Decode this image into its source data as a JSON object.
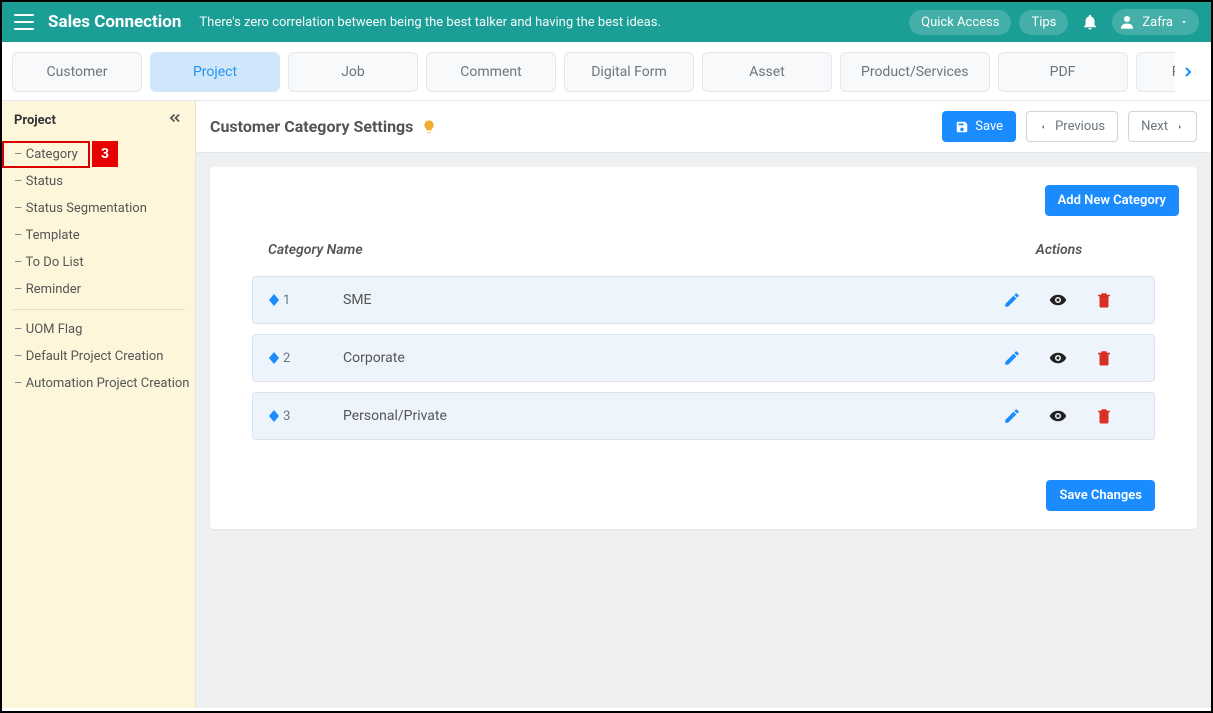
{
  "header": {
    "brand": "Sales Connection",
    "tagline": "There's zero correlation between being the best talker and having the best ideas.",
    "quick_access": "Quick Access",
    "tips": "Tips",
    "user_name": "Zafra"
  },
  "tabs": [
    {
      "label": "Customer",
      "active": false
    },
    {
      "label": "Project",
      "active": true
    },
    {
      "label": "Job",
      "active": false
    },
    {
      "label": "Comment",
      "active": false
    },
    {
      "label": "Digital Form",
      "active": false
    },
    {
      "label": "Asset",
      "active": false
    },
    {
      "label": "Product/Services",
      "active": false
    },
    {
      "label": "PDF",
      "active": false
    },
    {
      "label": "Public Fo",
      "active": false
    }
  ],
  "sidebar": {
    "title": "Project",
    "items_top": [
      {
        "label": "Category",
        "highlighted": true
      },
      {
        "label": "Status"
      },
      {
        "label": "Status Segmentation"
      },
      {
        "label": "Template"
      },
      {
        "label": "To Do List"
      },
      {
        "label": "Reminder"
      }
    ],
    "items_bottom": [
      {
        "label": "UOM Flag"
      },
      {
        "label": "Default Project Creation"
      },
      {
        "label": "Automation Project Creation"
      }
    ],
    "annotation_number": "3"
  },
  "toolbar": {
    "page_title": "Customer Category Settings",
    "save": "Save",
    "previous": "Previous",
    "next": "Next"
  },
  "card": {
    "add_new": "Add New Category",
    "col_name": "Category Name",
    "col_actions": "Actions",
    "rows": [
      {
        "num": "1",
        "name": "SME"
      },
      {
        "num": "2",
        "name": "Corporate"
      },
      {
        "num": "3",
        "name": "Personal/Private"
      }
    ],
    "save_changes": "Save Changes"
  }
}
